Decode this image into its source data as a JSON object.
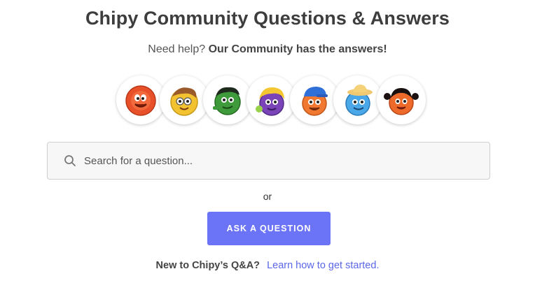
{
  "header": {
    "title": "Chipy Community Questions & Answers",
    "subtitle_lead": "Need help?",
    "subtitle_bold": "Our Community has the answers!"
  },
  "avatars": [
    {
      "name": "red-chip-avatar",
      "color": "#e8502a"
    },
    {
      "name": "yellow-chip-brown-hair-avatar",
      "color": "#f2c230"
    },
    {
      "name": "green-chip-avatar",
      "color": "#3e9a3a"
    },
    {
      "name": "purple-chip-yellow-hair-avatar",
      "color": "#7a43b8"
    },
    {
      "name": "orange-chip-blue-cap-avatar",
      "color": "#f07830"
    },
    {
      "name": "blue-chip-sunhat-avatar",
      "color": "#4aa8e8"
    },
    {
      "name": "orange-chip-pigtails-avatar",
      "color": "#ee6a2a"
    }
  ],
  "search": {
    "placeholder": "Search for a question...",
    "icon": "search-icon"
  },
  "divider_text": "or",
  "ask_button": {
    "label": "ASK A QUESTION",
    "color": "#6b74f6"
  },
  "footer": {
    "lead": "New to Chipy’s Q&A?",
    "link": "Learn how to get started.",
    "link_color": "#5b67e6"
  }
}
